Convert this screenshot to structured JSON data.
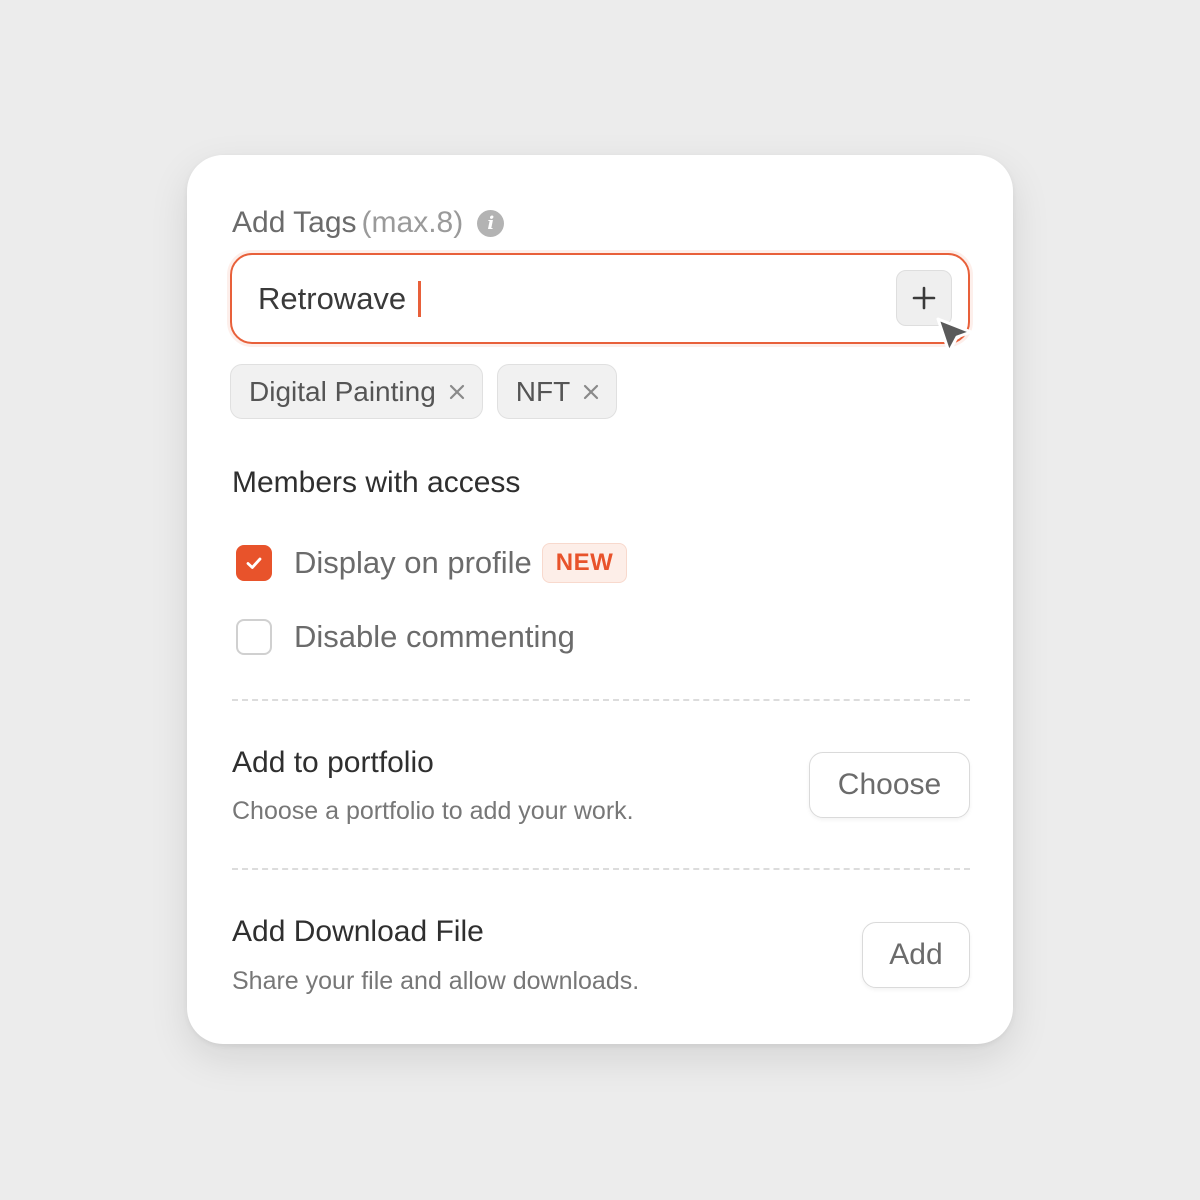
{
  "tags": {
    "title": "Add Tags",
    "max_hint": "(max.8)",
    "info_icon": "info-icon",
    "input_value": "Retrowave",
    "add_icon": "plus-icon",
    "chips": [
      {
        "label": "Digital Painting",
        "remove_icon": "close-icon"
      },
      {
        "label": "NFT",
        "remove_icon": "close-icon"
      }
    ]
  },
  "members": {
    "title": "Members with access",
    "options": [
      {
        "label": "Display on profile",
        "checked": true,
        "badge": "NEW"
      },
      {
        "label": "Disable commenting",
        "checked": false
      }
    ]
  },
  "portfolio": {
    "title": "Add to portfolio",
    "description": "Choose a portfolio to add your work.",
    "button_label": "Choose"
  },
  "download": {
    "title": "Add Download File",
    "description": "Share your file and allow downloads.",
    "button_label": "Add"
  },
  "colors": {
    "accent": "#e8532b",
    "accent_soft": "#fdeee8",
    "background": "#ececec",
    "card": "#ffffff"
  }
}
